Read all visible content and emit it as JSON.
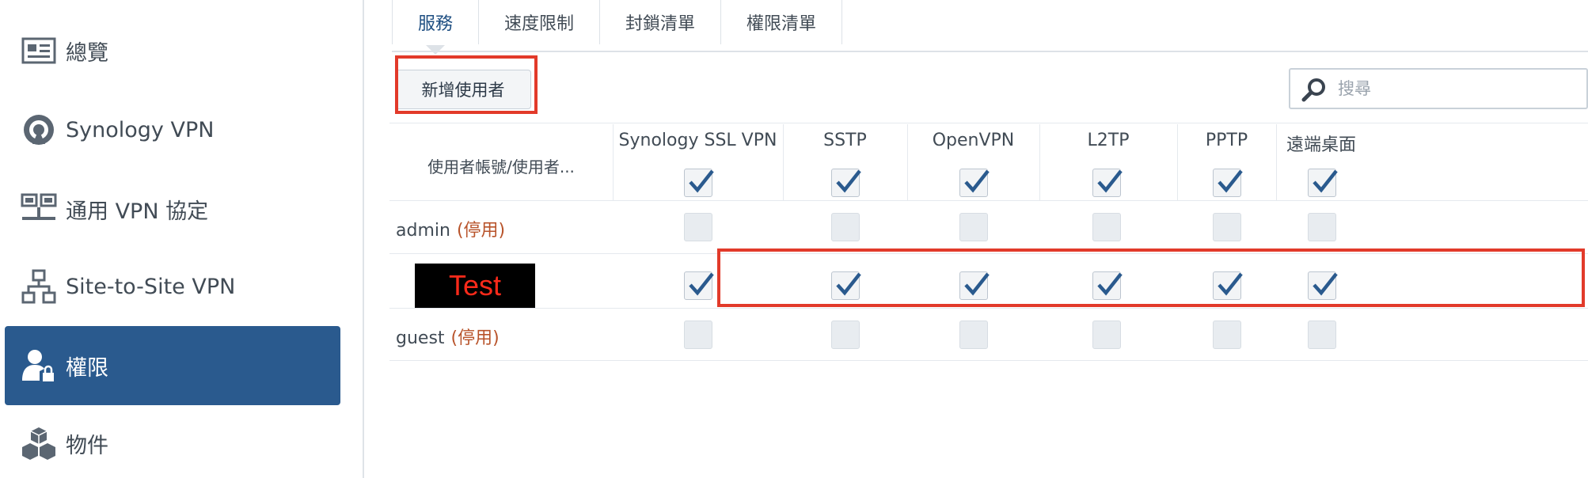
{
  "sidebar": {
    "items": [
      {
        "label": "總覽",
        "icon": "overview-icon",
        "active": false
      },
      {
        "label": "Synology VPN",
        "icon": "vpn-icon",
        "active": false
      },
      {
        "label": "通用 VPN 協定",
        "icon": "network-icon",
        "active": false
      },
      {
        "label": "Site-to-Site VPN",
        "icon": "sitemap-icon",
        "active": false
      },
      {
        "label": "權限",
        "icon": "user-lock-icon",
        "active": true
      },
      {
        "label": "物件",
        "icon": "cubes-icon",
        "active": false
      }
    ]
  },
  "tabs": [
    {
      "label": "服務",
      "active": true
    },
    {
      "label": "速度限制",
      "active": false
    },
    {
      "label": "封鎖清單",
      "active": false
    },
    {
      "label": "權限清單",
      "active": false
    }
  ],
  "toolbar": {
    "add_user_label": "新增使用者"
  },
  "search": {
    "placeholder": "搜尋",
    "value": ""
  },
  "table": {
    "user_column_header": "使用者帳號/使用者...",
    "columns": [
      "Synology SSL VPN",
      "SSTP",
      "OpenVPN",
      "L2TP",
      "PPTP",
      "遠端桌面"
    ],
    "header_checked": [
      true,
      true,
      true,
      true,
      true,
      true
    ],
    "rows": [
      {
        "name": "admin",
        "status": "(停用)",
        "checked": [
          false,
          false,
          false,
          false,
          false,
          false
        ]
      },
      {
        "name": "Test",
        "status": "",
        "checked": [
          true,
          true,
          true,
          true,
          true,
          true
        ]
      },
      {
        "name": "guest",
        "status": "(停用)",
        "checked": [
          false,
          false,
          false,
          false,
          false,
          false
        ]
      }
    ]
  },
  "colors": {
    "accent": "#2a5a8e",
    "highlight": "#e23a2a",
    "disabled_text": "#b8532a"
  }
}
